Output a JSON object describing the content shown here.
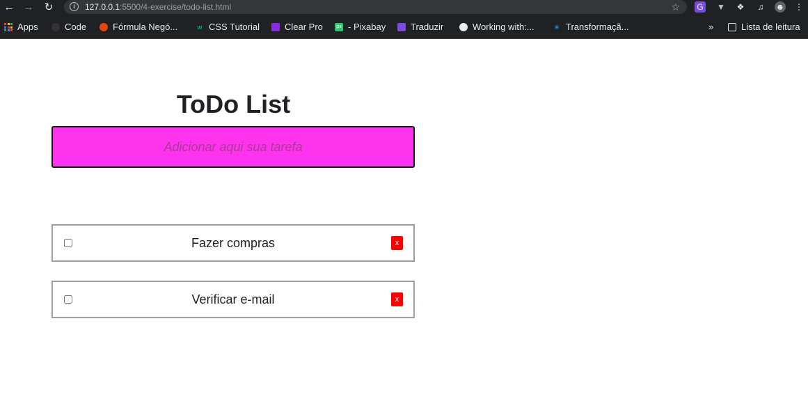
{
  "browser": {
    "url_host": "127.0.0.1",
    "url_rest": ":5500/4-exercise/todo-list.html",
    "bookmarks": [
      {
        "label": "Apps"
      },
      {
        "label": "Code"
      },
      {
        "label": "Fórmula Negó..."
      },
      {
        "label": "CSS Tutorial"
      },
      {
        "label": "Clear Pro"
      },
      {
        "label": "- Pixabay"
      },
      {
        "label": "Traduzir"
      },
      {
        "label": "Working with:..."
      },
      {
        "label": "Transformaçã..."
      }
    ],
    "more_bookmarks": "»",
    "reading_list": "Lista de leitura"
  },
  "page": {
    "title": "ToDo List",
    "input_placeholder": "Adicionar aqui sua tarefa",
    "todos": [
      {
        "text": "Fazer compras",
        "delete_label": "x"
      },
      {
        "text": "Verificar e-mail",
        "delete_label": "x"
      }
    ]
  },
  "colors": {
    "input_bg": "#ff33ee",
    "delete_bg": "#ff0000",
    "item_border": "#9e9e9e"
  }
}
